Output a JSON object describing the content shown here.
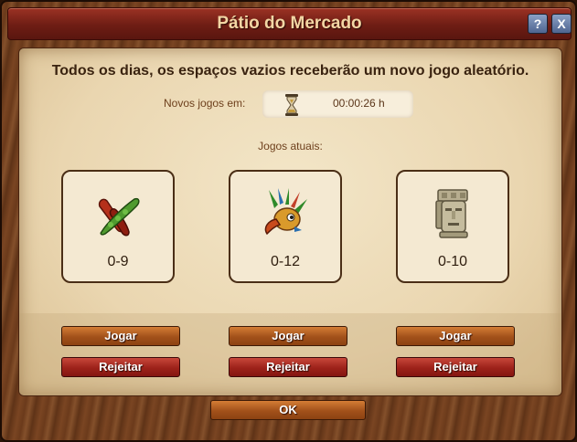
{
  "window": {
    "title": "Pátio do Mercado",
    "help_label": "?",
    "close_label": "X"
  },
  "panel": {
    "headline": "Todos os dias, os espaços vazios receberão um novo jogo aleatório.",
    "timer_label": "Novos jogos em:",
    "timer_value": "00:00:26 h",
    "current_label": "Jogos atuais:"
  },
  "games": [
    {
      "icon": "chili-peppers-icon",
      "range": "0-9",
      "play_label": "Jogar",
      "reject_label": "Rejeitar"
    },
    {
      "icon": "feathered-bird-mask-icon",
      "range": "0-12",
      "play_label": "Jogar",
      "reject_label": "Rejeitar"
    },
    {
      "icon": "stone-head-statue-icon",
      "range": "0-10",
      "play_label": "Jogar",
      "reject_label": "Rejeitar"
    }
  ],
  "footer": {
    "ok_label": "OK"
  }
}
